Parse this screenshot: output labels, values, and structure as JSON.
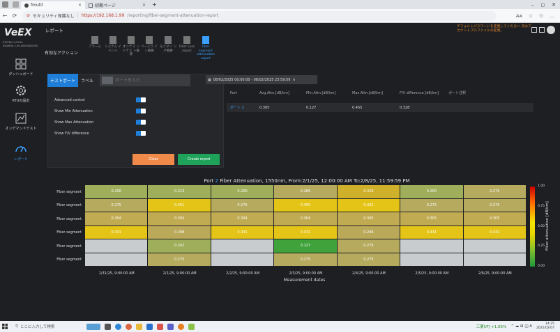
{
  "browser": {
    "tabs": [
      {
        "title": "fmutil"
      },
      {
        "title": "初期ページ"
      }
    ],
    "insecure_label": "セキュリティ保護なし",
    "url_host": "https://192.168.1.99",
    "url_path": "/reporting/fiber-segment-attenuation-report",
    "zoom_label": "Aᴀ"
  },
  "app": {
    "page_title": "レポート",
    "version_text": "SYSTEM 1.00.R4\nVIAVIEW: 1.00.00000000000",
    "warning_text": "デフォルトパスワードを変更してください 次はアカウントプロファイルの変更。",
    "sidebar": [
      {
        "label": "ダッシュボード"
      },
      {
        "label": "RTUの設定"
      },
      {
        "label": "オンデマンドテスト"
      },
      {
        "label": "レポート"
      }
    ],
    "actions_label": "有効なアクション",
    "actions": [
      {
        "label": "アラーム"
      },
      {
        "label": "システム イベント"
      },
      {
        "label": "オンデマ ンドテス ト概要"
      },
      {
        "label": "ベースラ イン概要"
      },
      {
        "label": "モニタリ ング概要"
      },
      {
        "label": "Fiber Loss report"
      },
      {
        "label": "Fiber segment attenuation report"
      }
    ],
    "report_tabs": [
      {
        "label": "テストポート"
      },
      {
        "label": "ラベル"
      }
    ],
    "port_placeholder": "ポートを入力",
    "options": [
      {
        "label": "Advanced control"
      },
      {
        "label": "Show Min Attenuation"
      },
      {
        "label": "Show Max Attenuation"
      },
      {
        "label": "Show F/V difference"
      }
    ],
    "buttons": {
      "clear": "Clear",
      "create": "Create report"
    },
    "date_range": "08/02/2025 00:00:00 - 08/02/2025 23:59:59",
    "result_table": {
      "headers": [
        "Port",
        "Avg.Attn.[dB/km]",
        "Min.Attn.[dB/km]",
        "Max.Attn.[dB/km]",
        "F/V difference [dB/km]",
        "ポート注釈"
      ],
      "rows": [
        [
          "ポート 2",
          "0.305",
          "0.127",
          "0.455",
          "0.328",
          ""
        ]
      ]
    },
    "heatmap_title_prefix": "Port ",
    "heatmap_title_port": "2",
    "heatmap_title_rest": " Fiber Attenuation, 1550nm, From:2/1/25, 12:00:00 AM To:2/8/25, 11:59:59 PM"
  },
  "chart_data": {
    "type": "heatmap",
    "title": "Port 2 Fiber Attenuation, 1550nm, From:2/1/25, 12:00:00 AM To:2/8/25, 11:59:59 PM",
    "xlabel": "Measurement dates",
    "colorbar_label": "Fiber attenuation [dB/km]",
    "colorbar_range": [
      0.0,
      1.0
    ],
    "colorbar_ticks": [
      "1.00",
      "0.75",
      "0.50",
      "0.25",
      "0.00"
    ],
    "x": [
      "1/31/25, 9:00:00 AM",
      "2/1/25, 9:00:00 AM",
      "2/2/25, 9:00:00 AM",
      "2/3/25, 9:00:00 AM",
      "2/4/25, 9:00:00 AM",
      "2/5/25, 9:00:00 AM",
      "2/6/25, 9:00:00 AM"
    ],
    "y": [
      "Fiber segment",
      "Fiber segment",
      "Fiber segment",
      "Fiber segment",
      "Fiber segment",
      "Fiber segment"
    ],
    "values": [
      [
        "0.200",
        "0.213",
        "0.200",
        "0.289",
        "0.329",
        "0.200",
        "0.275"
      ],
      [
        "0.275",
        "0.451",
        "0.275",
        "0.455",
        "0.452",
        "0.275",
        "0.275"
      ],
      [
        "0.304",
        "0.304",
        "0.304",
        "0.304",
        "0.305",
        "0.305",
        "0.305"
      ],
      [
        "0.431",
        "0.298",
        "0.431",
        "0.431",
        "0.296",
        "0.431",
        "0.432"
      ],
      [
        "",
        "0.242",
        "",
        "0.127",
        "0.279",
        "",
        ""
      ],
      [
        "",
        "0.275",
        "",
        "0.275",
        "0.275",
        "",
        ""
      ]
    ]
  },
  "taskbar": {
    "search_placeholder": "ここに入力して検索",
    "stock": "三菱UFJ +1.85%",
    "time": "14:25",
    "date": "2025/02/07"
  }
}
